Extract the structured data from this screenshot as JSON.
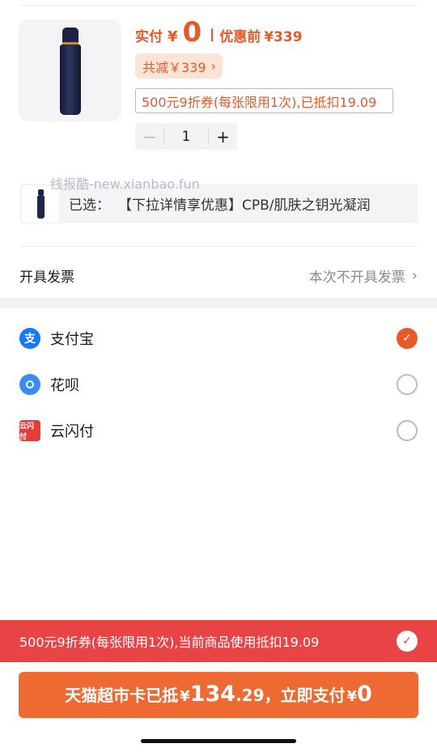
{
  "product": {
    "image_icon": "serum-bottle-image",
    "price_label": "实付",
    "currency": "¥",
    "paid_amount": "0",
    "original_label": "优惠前",
    "original_price": "¥339",
    "discount_total": "共减￥339",
    "coupon_note": "500元9折券(每张限用1次),已抵扣19.09",
    "quantity": "1",
    "minus": "－",
    "plus": "+"
  },
  "watermark": "线报酷-new.xianbao.fun",
  "selected": {
    "label": "已选：",
    "value": "【下拉详情享优惠】CPB/肌肤之钥光凝润"
  },
  "invoice": {
    "label": "开具发票",
    "value": "本次不开具发票"
  },
  "payment_methods": [
    {
      "name": "支付宝",
      "icon": "alipay-icon",
      "glyph": "支",
      "checked": true
    },
    {
      "name": "花呗",
      "icon": "huabei-icon",
      "glyph": "",
      "checked": false
    },
    {
      "name": "云闪付",
      "icon": "unionpay-icon",
      "glyph": "云闪付",
      "checked": false
    }
  ],
  "coupon_bar": {
    "text": "500元9折券(每张限用1次),当前商品使用抵扣19.09",
    "checked": true
  },
  "pay_button": {
    "prefix": "天猫超市卡已抵",
    "currency": "¥",
    "deducted_int": "134",
    "deducted_dec": ".29",
    "middle": "，立即支付",
    "pay_amount": "0"
  },
  "colors": {
    "accent": "#e8592a",
    "bar_red": "#e84345",
    "button_orange": "#ee6a33"
  }
}
